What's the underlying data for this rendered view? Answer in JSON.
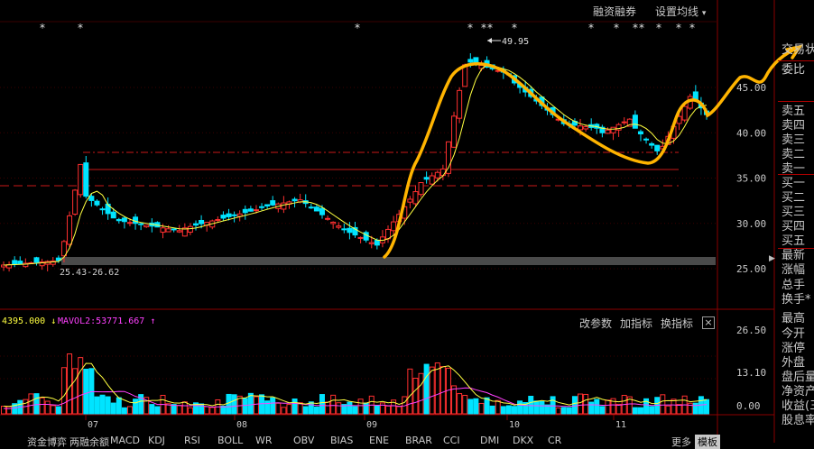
{
  "toolbar": {
    "margin_trading": "融资融券",
    "ma_settings": "设置均线",
    "dropdown_glyph": "▾"
  },
  "price_axis": {
    "ticks": [
      "45.00",
      "40.00",
      "35.00",
      "30.00",
      "25.00"
    ]
  },
  "annotations": {
    "high_marker": "49.95",
    "range_label": "25.43-26.62",
    "star": "*"
  },
  "volume_panel": {
    "legend_vol": "4395.000",
    "legend_ma12": "MAVOL2:53771.667",
    "axis_ticks": [
      "26.50",
      "13.10",
      "0.00"
    ],
    "buttons": {
      "change_params": "改参数",
      "add_indicator": "加指标",
      "swap_indicator": "换指标",
      "close": "×"
    }
  },
  "date_axis": {
    "labels": [
      "07",
      "08",
      "09",
      "10",
      "11"
    ]
  },
  "right_panel": {
    "labels": [
      "交易状",
      "委比",
      "卖五",
      "卖四",
      "卖三",
      "卖二",
      "卖一",
      "买一",
      "买二",
      "买三",
      "买四",
      "买五",
      "最新",
      "涨幅",
      "总手",
      "换手*",
      "最高",
      "今开",
      "涨停",
      "外盘",
      "盘后量",
      "净资产",
      "收益(三",
      "股息率"
    ]
  },
  "bottom_tabs": [
    "资金博弈",
    "两融余额",
    "MACD",
    "KDJ",
    "RSI",
    "BOLL",
    "WR",
    "OBV",
    "BIAS",
    "ENE",
    "BRAR",
    "CCI",
    "DMI",
    "DKX",
    "CR",
    "更多"
  ],
  "bottom_tabs_right": "模板",
  "colors": {
    "up": "#ff3030",
    "down": "#00e4ff",
    "ma_line": "#ffff40",
    "vol_ma": "#ff40ff",
    "drawn_curve": "#ffb400",
    "hline": "#c81818",
    "bg": "#000000"
  }
}
